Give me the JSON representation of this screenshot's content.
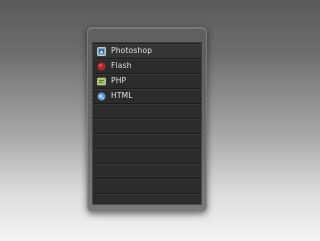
{
  "menu": {
    "items": [
      {
        "label": "Photoshop",
        "icon": "photoshop-icon"
      },
      {
        "label": "Flash",
        "icon": "flash-icon"
      },
      {
        "label": "PHP",
        "icon": "php-icon"
      },
      {
        "label": "HTML",
        "icon": "html-globe-icon"
      }
    ],
    "empty_rows": 7
  },
  "colors": {
    "panel_border": "#969696",
    "list_background": "#2c2c2c",
    "text": "#e4e4e4"
  }
}
